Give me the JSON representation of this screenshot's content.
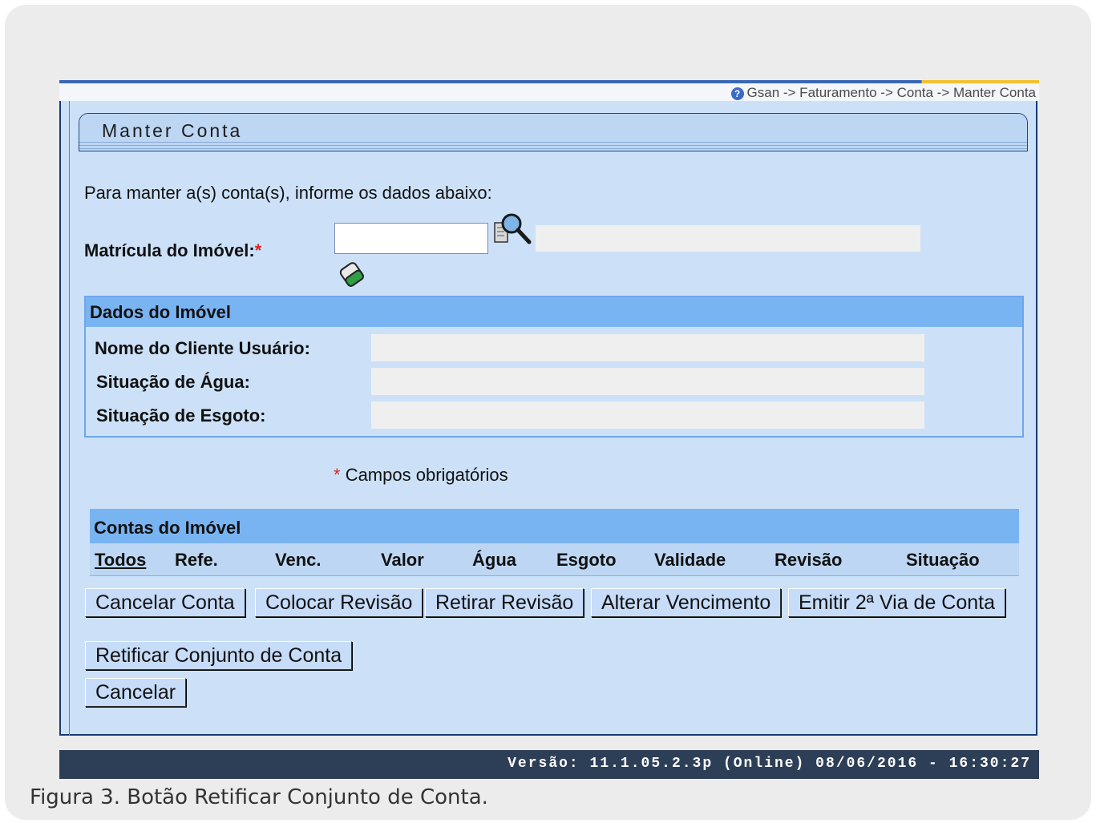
{
  "breadcrumb": "Gsan -> Faturamento -> Conta -> Manter Conta",
  "title": "Manter Conta",
  "instructions": "Para manter a(s) conta(s), informe os dados abaixo:",
  "matricula": {
    "label": "Matrícula do Imóvel:",
    "required_mark": "*",
    "value": ""
  },
  "dados_imovel": {
    "header": "Dados do Imóvel",
    "fields": [
      {
        "label": "Nome do Cliente Usuário:",
        "value": ""
      },
      {
        "label": "Situação de Água:",
        "value": ""
      },
      {
        "label": "Situação de Esgoto:",
        "value": ""
      }
    ]
  },
  "required_note": {
    "mark": "*",
    "text": "Campos obrigatórios"
  },
  "contas": {
    "header": "Contas do Imóvel",
    "columns": [
      "Todos",
      "Refe.",
      "Venc.",
      "Valor",
      "Água",
      "Esgoto",
      "Validade",
      "Revisão",
      "Situação"
    ]
  },
  "buttons": {
    "cancelar_conta": "Cancelar Conta",
    "colocar_revisao": "Colocar Revisão",
    "retirar_revisao": "Retirar Revisão",
    "alterar_vencimento": "Alterar Vencimento",
    "emitir_2via": "Emitir 2ª Via de Conta",
    "retificar_conjunto": "Retificar Conjunto de Conta",
    "cancelar": "Cancelar"
  },
  "footer": "Versão: 11.1.05.2.3p (Online) 08/06/2016 - 16:30:27",
  "caption": "Figura 3. Botão Retificar Conjunto de Conta.",
  "colors": {
    "panel": "#cce1f8",
    "section_header": "#79b4f2",
    "footer": "#2d3e57"
  }
}
